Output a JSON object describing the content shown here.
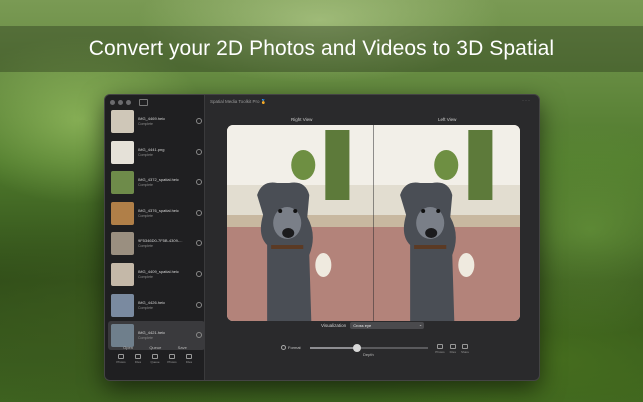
{
  "banner": {
    "headline": "Convert your 2D Photos and Videos to 3D Spatial"
  },
  "window": {
    "title": "Spatial Media Toolkit Pro",
    "title_badge": "🏅",
    "right_view_label": "Right View",
    "left_view_label": "Left View",
    "visualization_label": "Visualization",
    "visualization_value": "Cross eye",
    "format_label": "Format",
    "depth_label": "Depth",
    "depth_value": 0.4
  },
  "sidebar": {
    "files": [
      {
        "name": "IMG_4469.heic",
        "status": "Complete",
        "thumb_color": "#cfc7b8"
      },
      {
        "name": "IMG_4441.png",
        "status": "Complete",
        "thumb_color": "#e5e1d8"
      },
      {
        "name": "IMG_4372_spatial.heic",
        "status": "Complete",
        "thumb_color": "#6e8b4a"
      },
      {
        "name": "IMG_4376_spatial.heic",
        "status": "Complete",
        "thumb_color": "#b07f48"
      },
      {
        "name": "9F5346D0-7F5B-4309-...",
        "status": "Complete",
        "thumb_color": "#9a8f80"
      },
      {
        "name": "IMG_4409_spatial.heic",
        "status": "Complete",
        "thumb_color": "#c4b8a8"
      },
      {
        "name": "IMG_4426.heic",
        "status": "Complete",
        "thumb_color": "#7a8aa0"
      },
      {
        "name": "IMG_4421.heic",
        "status": "Complete",
        "thumb_color": "#6f7f8c"
      }
    ],
    "groups": {
      "open": "Open",
      "queue": "Queue",
      "save": "Save"
    },
    "buttons": [
      "Photos",
      "Files",
      "Queue",
      "Photos",
      "Files"
    ]
  },
  "actions": [
    "Photos",
    "Files",
    "Share"
  ]
}
